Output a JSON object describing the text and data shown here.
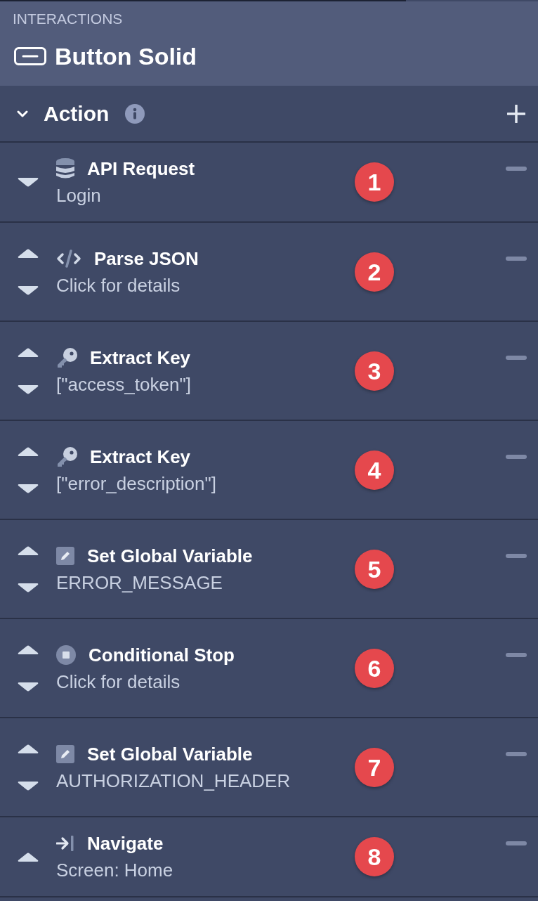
{
  "panel": {
    "section_label": "INTERACTIONS",
    "component_name": "Button Solid"
  },
  "action_header": {
    "label": "Action",
    "expanded": true
  },
  "actions": [
    {
      "kind": "api_request",
      "title": "API Request",
      "detail": "Login",
      "badge": "1",
      "can_move_up": false,
      "can_move_down": true
    },
    {
      "kind": "parse_json",
      "title": "Parse JSON",
      "detail": "Click for details",
      "badge": "2",
      "can_move_up": true,
      "can_move_down": true
    },
    {
      "kind": "extract_key",
      "title": "Extract Key",
      "detail": "[\"access_token\"]",
      "badge": "3",
      "can_move_up": true,
      "can_move_down": true
    },
    {
      "kind": "extract_key",
      "title": "Extract Key",
      "detail": "[\"error_description\"]",
      "badge": "4",
      "can_move_up": true,
      "can_move_down": true
    },
    {
      "kind": "set_variable",
      "title": "Set Global Variable",
      "detail": "ERROR_MESSAGE",
      "badge": "5",
      "can_move_up": true,
      "can_move_down": true
    },
    {
      "kind": "conditional_stop",
      "title": "Conditional Stop",
      "detail": "Click for details",
      "badge": "6",
      "can_move_up": true,
      "can_move_down": true
    },
    {
      "kind": "set_variable",
      "title": "Set Global Variable",
      "detail": "AUTHORIZATION_HEADER",
      "badge": "7",
      "can_move_up": true,
      "can_move_down": true
    },
    {
      "kind": "navigate",
      "title": "Navigate",
      "detail": "Screen: Home",
      "badge": "8",
      "can_move_up": true,
      "can_move_down": false
    }
  ]
}
